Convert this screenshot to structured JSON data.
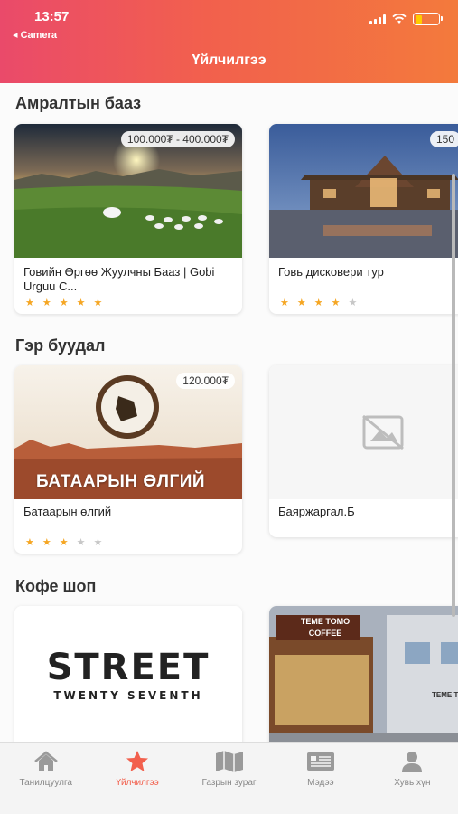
{
  "status": {
    "time": "13:57",
    "back": "◂ Camera"
  },
  "header": {
    "title": "Үйлчилгээ"
  },
  "sections": [
    {
      "title": "Амралтын бааз",
      "cards": [
        {
          "name": "Говийн Өргөө Жуулчны Бааз | Gobi Urguu C...",
          "price": "100.000₮ - 400.000₮",
          "rating": 5
        },
        {
          "name": "Говь дисковери тур",
          "price": "150",
          "rating": 4
        }
      ]
    },
    {
      "title": "Гэр буудал",
      "cards": [
        {
          "name": "Батаарын өлгий",
          "price": "120.000₮",
          "rating": 3,
          "image_caption": "БАТААРЫН ӨЛГИЙ"
        },
        {
          "name": "Баяржаргал.Б",
          "price": "",
          "rating": 0
        }
      ]
    },
    {
      "title": "Кофе шоп",
      "cards": [
        {
          "name": "",
          "price": "",
          "logo_line1": "STREET",
          "logo_line2": "TWENTY SEVENTH"
        },
        {
          "name": "",
          "price": "",
          "sign": "TEME TOMO COFFEE",
          "sign2": "TEME T"
        }
      ]
    }
  ],
  "tabs": [
    {
      "label": "Танилцуулга",
      "icon": "home-icon",
      "active": false
    },
    {
      "label": "Үйлчилгээ",
      "icon": "star-icon",
      "active": true
    },
    {
      "label": "Газрын зураг",
      "icon": "map-icon",
      "active": false
    },
    {
      "label": "Мэдээ",
      "icon": "news-icon",
      "active": false
    },
    {
      "label": "Хувь хүн",
      "icon": "person-icon",
      "active": false
    }
  ],
  "colors": {
    "accent": "#f2604d",
    "star": "#f5a623",
    "header_start": "#ea4a6a",
    "header_end": "#f37a3c"
  }
}
